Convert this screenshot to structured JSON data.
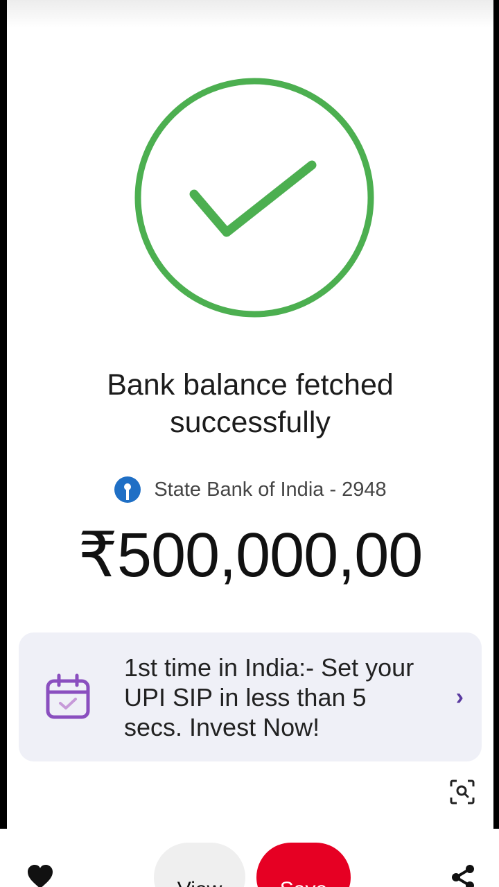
{
  "result": {
    "status": "success",
    "headline": "Bank balance fetched successfully",
    "bank_name": "State Bank of India - 2948",
    "balance": "₹500,000,00"
  },
  "promo": {
    "text": "1st time in India:- Set your UPI SIP in less than 5 secs. Invest Now!",
    "icon": "calendar-check-icon",
    "chevron": "›"
  },
  "bottom_bar": {
    "view_label": "View",
    "save_label": "Save",
    "icons": [
      "heart-icon",
      "share-icon",
      "visual-search-icon"
    ]
  },
  "colors": {
    "success_green": "#4caf50",
    "bank_blue": "#1f6fc5",
    "promo_purple": "#8a4fbf",
    "save_red": "#e60023",
    "card_bg": "#eff0f7"
  }
}
